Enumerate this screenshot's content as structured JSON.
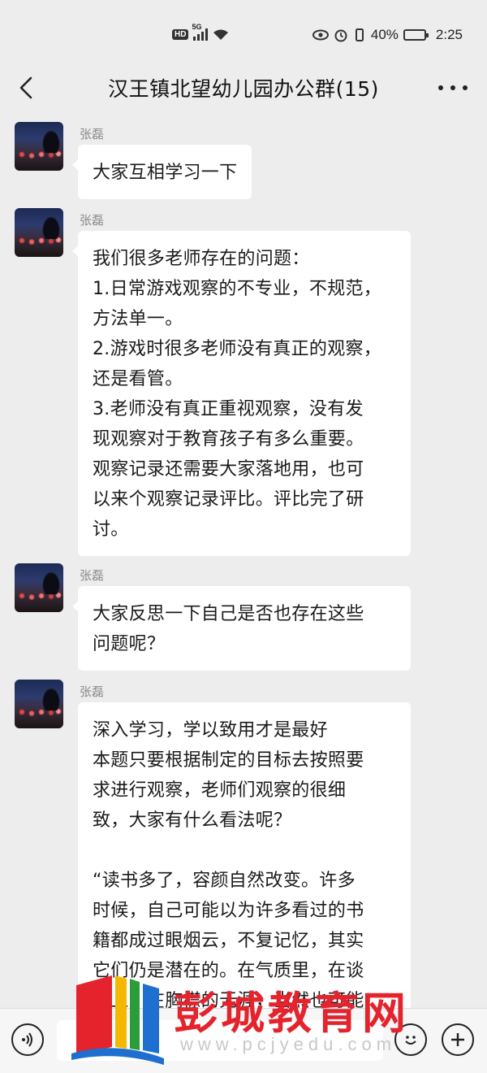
{
  "status_bar": {
    "hd": "HD",
    "network": "5G",
    "battery_text": "40%",
    "battery_level": 0.4,
    "time": "2:25"
  },
  "header": {
    "title": "汉王镇北望幼儿园办公群(15)"
  },
  "messages": [
    {
      "sender": "张磊",
      "lines": [
        "大家互相学习一下"
      ]
    },
    {
      "sender": "张磊",
      "lines": [
        "我们很多老师存在的问题：",
        "1.日常游戏观察的不专业，不规范，",
        "方法单一。",
        "2.游戏时很多老师没有真正的观察，",
        "还是看管。",
        "3.老师没有真正重视观察，没有发",
        "现观察对于教育孩子有多么重要。",
        "观察记录还需要大家落地用，也可",
        "以来个观察记录评比。评比完了研",
        "讨。"
      ]
    },
    {
      "sender": "张磊",
      "lines": [
        "大家反思一下自己是否也存在这些",
        "问题呢？"
      ]
    },
    {
      "sender": "张磊",
      "lines": [
        "深入学习，学以致用才是最好",
        "本题只要根据制定的目标去按照要",
        "求进行观察，老师们观察的很细",
        "致，大家有什么看法呢？",
        "",
        "“读书多了，容颜自然改变。许多",
        "时候，自己可能以为许多看过的书",
        "籍都成过眼烟云，不复记忆，其实",
        "它们仍是潜在的。在气质里，在谈",
        "吐上，在胸襟的无涯，当然也可能"
      ]
    }
  ],
  "watermark": {
    "text": "彭城教育网",
    "url": "www.pcjyedu.com"
  },
  "icons": {
    "back": "back-arrow-icon",
    "more": "more-icon",
    "voice": "voice-icon",
    "emoji": "emoji-icon",
    "plus": "plus-icon"
  }
}
